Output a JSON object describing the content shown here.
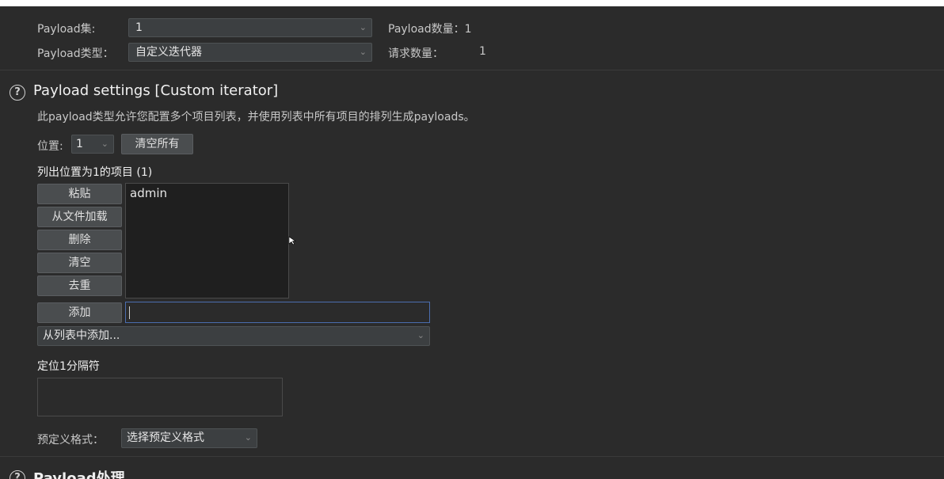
{
  "top": {
    "payload_set_label": "Payload集:",
    "payload_set_value": "1",
    "payload_count_label": "Payload数量：1",
    "payload_type_label": "Payload类型：",
    "payload_type_value": "自定义迭代器",
    "request_count_label": "请求数量：",
    "request_count_value": "1"
  },
  "settings": {
    "title": "Payload settings [Custom iterator]",
    "description": "此payload类型允许您配置多个项目列表，并使用列表中所有项目的排列生成payloads。",
    "position_label": "位置:",
    "position_value": "1",
    "clear_all_label": "清空所有",
    "list_title": "列出位置为1的项目 (1)",
    "buttons": {
      "paste": "粘贴",
      "load": "从文件加载",
      "remove": "删除",
      "clear": "清空",
      "dedupe": "去重",
      "add": "添加"
    },
    "items": [
      "admin"
    ],
    "add_from_list_value": "从列表中添加...",
    "separator_title": "定位1分隔符",
    "predef_label": "预定义格式：",
    "predef_value": "选择预定义格式"
  },
  "next_section": {
    "title": "Payload处理"
  },
  "icons": {
    "help": "question-circle-icon",
    "dropdown": "chevron-down-icon",
    "cursor": "pointer-arrow-icon"
  }
}
